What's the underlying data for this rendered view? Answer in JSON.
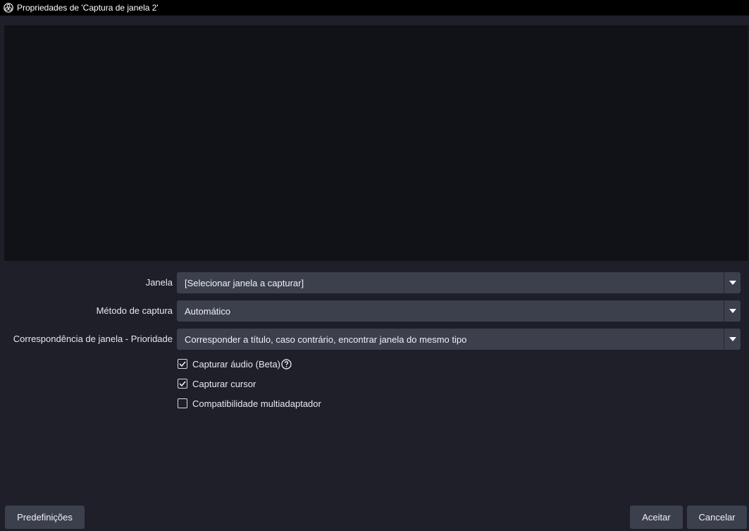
{
  "window": {
    "title": "Propriedades de 'Captura de janela 2'",
    "icon": "obs-logo-icon"
  },
  "form": {
    "rows": [
      {
        "label": "Janela",
        "value": "[Selecionar janela a capturar]"
      },
      {
        "label": "Método de captura",
        "value": "Automático"
      },
      {
        "label": "Correspondência de janela - Prioridade",
        "value": "Corresponder a título, caso contrário, encontrar janela do mesmo tipo"
      }
    ],
    "checkboxes": [
      {
        "label": "Capturar áudio (Beta)",
        "checked": true,
        "help_icon": "help-icon"
      },
      {
        "label": "Capturar cursor",
        "checked": true
      },
      {
        "label": "Compatibilidade multiadaptador",
        "checked": false
      }
    ]
  },
  "buttons": {
    "defaults": "Predefinições",
    "ok": "Aceitar",
    "cancel": "Cancelar"
  },
  "colors": {
    "background": "#1e1f29",
    "preview": "#111217",
    "control": "#3c404d",
    "titlebar": "#000000"
  }
}
